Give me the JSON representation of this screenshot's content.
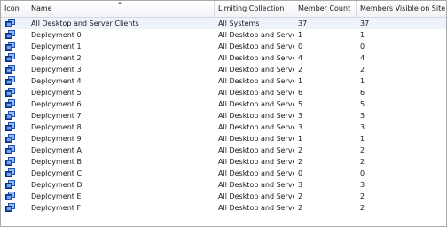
{
  "columns": {
    "icon": "Icon",
    "name": "Name",
    "limiting": "Limiting Collection",
    "member_count": "Member Count",
    "visible": "Members Visible on Site"
  },
  "icon_name": "collection-icon",
  "accent": "#1b50b8",
  "rows": [
    {
      "name": "All Desktop and Server Clients",
      "limiting": "All Systems",
      "member_count": "37",
      "visible": "37"
    },
    {
      "name": "Deployment 0",
      "limiting": "All Desktop and Server...",
      "member_count": "1",
      "visible": "1"
    },
    {
      "name": "Deployment 1",
      "limiting": "All Desktop and Server...",
      "member_count": "0",
      "visible": "0"
    },
    {
      "name": "Deployment 2",
      "limiting": "All Desktop and Server...",
      "member_count": "4",
      "visible": "4"
    },
    {
      "name": "Deployment 3",
      "limiting": "All Desktop and Server...",
      "member_count": "2",
      "visible": "2"
    },
    {
      "name": "Deployment 4",
      "limiting": "All Desktop and Server...",
      "member_count": "1",
      "visible": "1"
    },
    {
      "name": "Deployment 5",
      "limiting": "All Desktop and Server...",
      "member_count": "6",
      "visible": "6"
    },
    {
      "name": "Deployment 6",
      "limiting": "All Desktop and Server...",
      "member_count": "5",
      "visible": "5"
    },
    {
      "name": "Deployment 7",
      "limiting": "All Desktop and Server...",
      "member_count": "3",
      "visible": "3"
    },
    {
      "name": "Deployment 8",
      "limiting": "All Desktop and Server...",
      "member_count": "3",
      "visible": "3"
    },
    {
      "name": "Deployment 9",
      "limiting": "All Desktop and Server...",
      "member_count": "1",
      "visible": "1"
    },
    {
      "name": "Deployment A",
      "limiting": "All Desktop and Server...",
      "member_count": "2",
      "visible": "2"
    },
    {
      "name": "Deployment B",
      "limiting": "All Desktop and Server...",
      "member_count": "2",
      "visible": "2"
    },
    {
      "name": "Deployment C",
      "limiting": "All Desktop and Server...",
      "member_count": "0",
      "visible": "0"
    },
    {
      "name": "Deployment D",
      "limiting": "All Desktop and Server...",
      "member_count": "3",
      "visible": "3"
    },
    {
      "name": "Deployment E",
      "limiting": "All Desktop and Server...",
      "member_count": "2",
      "visible": "2"
    },
    {
      "name": "Deployment F",
      "limiting": "All Desktop and Server...",
      "member_count": "2",
      "visible": "2"
    }
  ]
}
